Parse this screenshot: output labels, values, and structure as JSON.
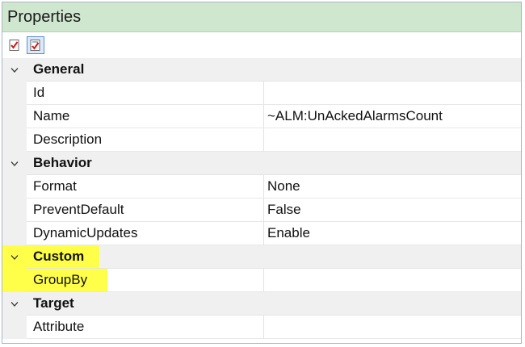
{
  "panel": {
    "title": "Properties"
  },
  "toolbar": {
    "buttons": [
      {
        "icon": "categorized-icon",
        "active": false
      },
      {
        "icon": "property-pages-icon",
        "active": true
      }
    ]
  },
  "categories": [
    {
      "name": "General",
      "expanded": true,
      "highlighted": false,
      "properties": [
        {
          "name": "Id",
          "value": ""
        },
        {
          "name": "Name",
          "value": "~ALM:UnAckedAlarmsCount"
        },
        {
          "name": "Description",
          "value": ""
        }
      ]
    },
    {
      "name": "Behavior",
      "expanded": true,
      "highlighted": false,
      "properties": [
        {
          "name": "Format",
          "value": "None"
        },
        {
          "name": "PreventDefault",
          "value": "False"
        },
        {
          "name": "DynamicUpdates",
          "value": "Enable"
        }
      ]
    },
    {
      "name": "Custom",
      "expanded": true,
      "highlighted": true,
      "properties": [
        {
          "name": "GroupBy",
          "value": "",
          "highlighted": true
        }
      ]
    },
    {
      "name": "Target",
      "expanded": true,
      "highlighted": false,
      "properties": [
        {
          "name": "Attribute",
          "value": ""
        }
      ]
    }
  ],
  "colors": {
    "title_bg": "#cfe6cf",
    "highlight": "#ffff4a",
    "category_bg": "#f0f0f0"
  }
}
